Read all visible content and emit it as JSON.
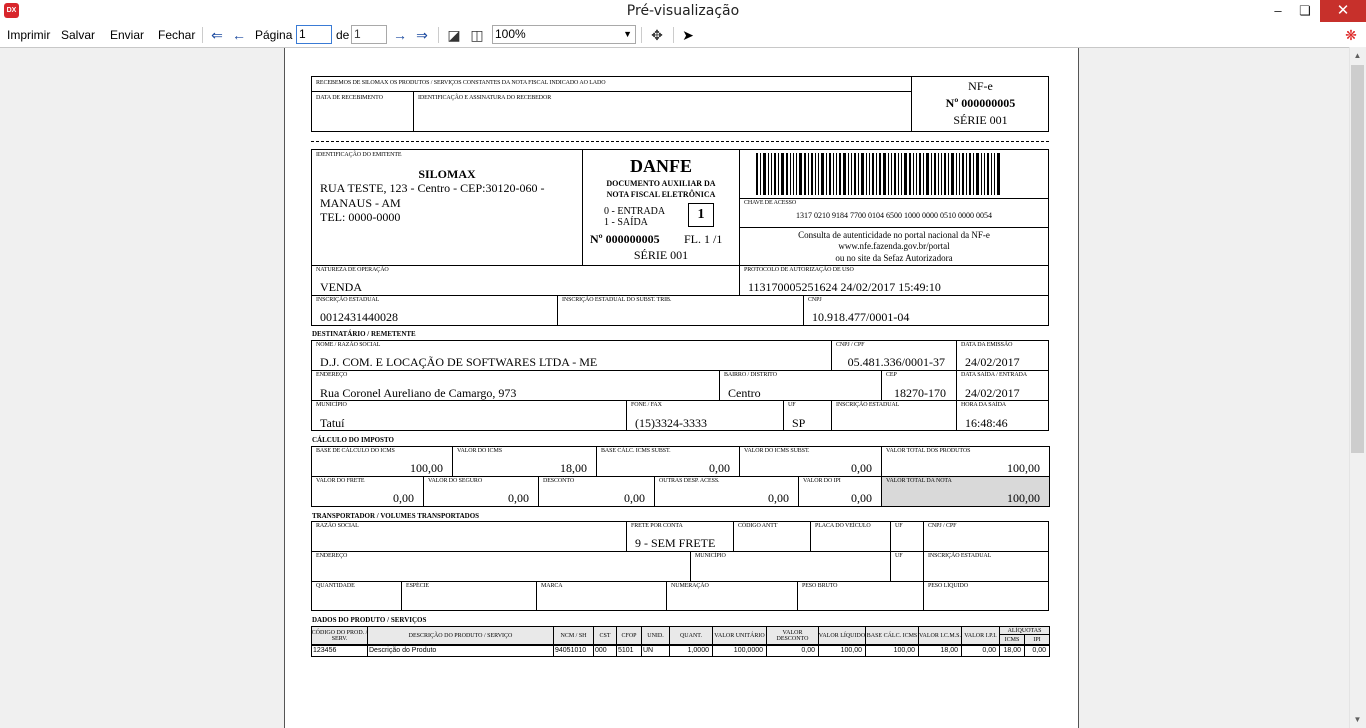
{
  "window": {
    "title": "Pré-visualização",
    "icon": "devexpress-logo-icon",
    "icon_text": "DX"
  },
  "toolbar": {
    "print": "Imprimir",
    "save": "Salvar",
    "send": "Enviar",
    "close": "Fechar",
    "page_label": "Página",
    "page_value": "1",
    "of_label": "de",
    "total_pages": "1",
    "zoom": "100%"
  },
  "nfe_stub": {
    "received_text": "RECEBEMOS DE SILOMAX OS PRODUTOS / SERVIÇOS CONSTANTES DA NOTA FISCAL INDICADO AO LADO",
    "date_label": "DATA DE RECEBIMENTO",
    "signature_label": "IDENTIFICAÇÃO E ASSINATURA DO RECEBEDOR",
    "nfe": "NF-e",
    "number": "Nº 000000005",
    "series": "SÉRIE 001"
  },
  "issuer": {
    "label": "IDENTIFICAÇÃO DO EMITENTE",
    "name": "SILOMAX",
    "address1": "RUA TESTE, 123  - Centro - CEP:30120-060 -",
    "address2": "MANAUS - AM",
    "phone": "TEL: 0000-0000"
  },
  "danfe": {
    "title": "DANFE",
    "subtitle1": "DOCUMENTO AUXILIAR DA",
    "subtitle2": "NOTA FISCAL ELETRÔNICA",
    "entry": "0 - ENTRADA",
    "exit": "1 - SAÍDA",
    "type": "1",
    "number": "Nº 000000005",
    "sheet": "FL. 1 /1",
    "series": "SÉRIE 001"
  },
  "access": {
    "label": "CHAVE DE ACESSO",
    "key": "1317 0210 9184 7700 0104 6500 1000 0000 0510 0000 0054",
    "consult1": "Consulta de autenticidade no portal nacional da NF-e",
    "consult2": "www.nfe.fazenda.gov.br/portal",
    "consult3": "ou no site da Sefaz Autorizadora"
  },
  "operation": {
    "nature_label": "NATUREZA DE OPERAÇÃO",
    "nature": "VENDA",
    "protocol_label": "PROTOCOLO DE AUTORIZAÇÃO DE USO",
    "protocol": "113170005251624 24/02/2017 15:49:10",
    "ie_label": "INSCRIÇÃO ESTADUAL",
    "ie": "0012431440028",
    "ie_st_label": "INSCRIÇÃO ESTADUAL DO SUBST. TRIB.",
    "cnpj_label": "CNPJ",
    "cnpj": "10.918.477/0001-04"
  },
  "recipient": {
    "section": "DESTINATÁRIO / REMETENTE",
    "name_label": "NOME / RAZÃO SOCIAL",
    "name": "D.J. COM. E LOCAÇÃO DE SOFTWARES LTDA - ME",
    "cnpj_label": "CNPJ / CPF",
    "cnpj": "05.481.336/0001-37",
    "emission_label": "DATA DA EMISSÃO",
    "emission": "24/02/2017",
    "address_label": "ENDEREÇO",
    "address": "Rua Coronel Aureliano de Camargo, 973",
    "district_label": "BAIRRO / DISTRITO",
    "district": "Centro",
    "cep_label": "CEP",
    "cep": "18270-170",
    "exit_label": "DATA SAÍDA / ENTRADA",
    "exit": "24/02/2017",
    "city_label": "MUNICÍPIO",
    "city": "Tatuí",
    "phone_label": "FONE / FAX",
    "phone": "(15)3324-3333",
    "uf_label": "UF",
    "uf": "SP",
    "ie_label": "INSCRIÇÃO ESTADUAL",
    "time_label": "HORA DA SAÍDA",
    "time": "16:48:46"
  },
  "tax": {
    "section": "CÁLCULO DO IMPOSTO",
    "row1": [
      {
        "label": "BASE DE CÁLCULO DO ICMS",
        "value": "100,00"
      },
      {
        "label": "VALOR DO ICMS",
        "value": "18,00"
      },
      {
        "label": "BASE CÁLC. ICMS SUBST.",
        "value": "0,00"
      },
      {
        "label": "VALOR DO ICMS SUBST.",
        "value": "0,00"
      },
      {
        "label": "VALOR TOTAL DOS PRODUTOS",
        "value": "100,00"
      }
    ],
    "row2": [
      {
        "label": "VALOR DO FRETE",
        "value": "0,00"
      },
      {
        "label": "VALOR DO SEGURO",
        "value": "0,00"
      },
      {
        "label": "DESCONTO",
        "value": "0,00"
      },
      {
        "label": "OUTRAS DESP. ACESS.",
        "value": "0,00"
      },
      {
        "label": "VALOR DO IPI",
        "value": "0,00"
      },
      {
        "label": "VALOR TOTAL DA NOTA",
        "value": "100,00"
      }
    ]
  },
  "transport": {
    "section": "TRANSPORTADOR / VOLUMES TRANSPORTADOS",
    "name_label": "RAZÃO SOCIAL",
    "freight_label": "FRETE POR CONTA",
    "freight": "9 - SEM FRETE",
    "antt_label": "CÓDIGO ANTT",
    "plate_label": "PLACA DO VEÍCULO",
    "uf_label": "UF",
    "cnpj_label": "CNPJ / CPF",
    "address_label": "ENDEREÇO",
    "city_label": "MUNICÍPIO",
    "uf2_label": "UF",
    "ie_label": "INSCRIÇÃO ESTADUAL",
    "qty_label": "QUANTIDADE",
    "kind_label": "ESPÉCIE",
    "brand_label": "MARCA",
    "numbering_label": "NUMERAÇÃO",
    "gross_label": "PESO BRUTO",
    "net_label": "PESO LÍQUIDO"
  },
  "products": {
    "section": "DADOS DO PRODUTO / SERVIÇOS",
    "headers": [
      "CÓDIGO DO PROD. / SERV.",
      "DESCRIÇÃO DO PRODUTO / SERVIÇO",
      "NCM / SH",
      "CST",
      "CFOP",
      "UNID.",
      "QUANT.",
      "VALOR UNITÁRIO",
      "VALOR DESCONTO",
      "VALOR LÍQUIDO",
      "BASE CÁLC. ICMS",
      "VALOR I.C.M.S.",
      "VALOR I.P.I.",
      "ALÍQUOTAS"
    ],
    "aliq_sub": [
      "ICMS",
      "IPI"
    ],
    "rows": [
      [
        "123456",
        "Descrição do Produto",
        "94051010",
        "000",
        "5101",
        "UN",
        "1,0000",
        "100,0000",
        "0,00",
        "100,00",
        "100,00",
        "18,00",
        "0,00",
        "18,00",
        "0,00"
      ]
    ]
  }
}
